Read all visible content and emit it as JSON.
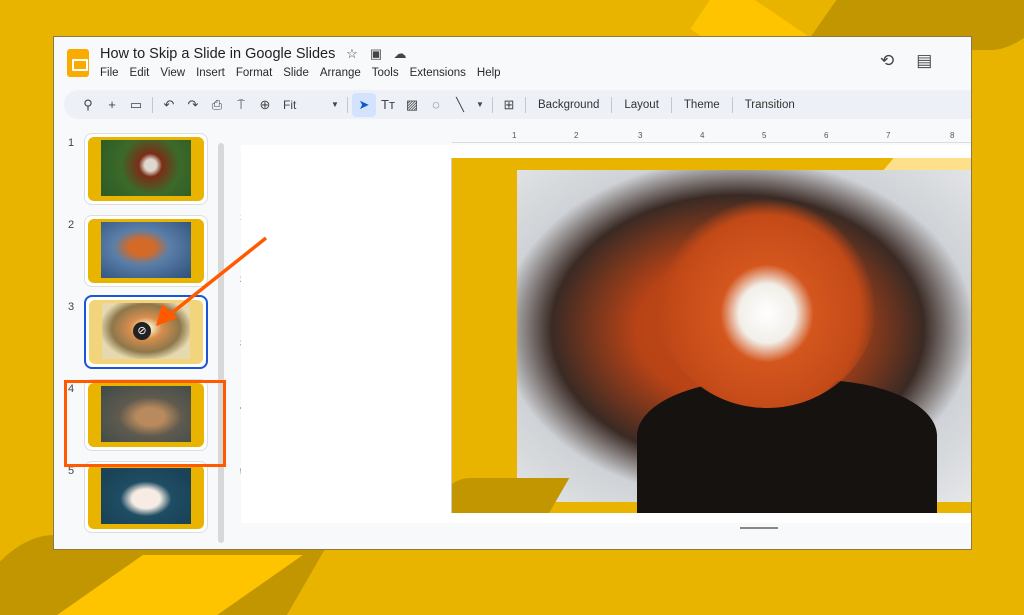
{
  "app": {
    "title": "How to Skip a Slide in Google Slides",
    "title_icons": [
      "star-icon",
      "move-folder-icon",
      "cloud-saved-icon"
    ],
    "menu": [
      "File",
      "Edit",
      "View",
      "Insert",
      "Format",
      "Slide",
      "Arrange",
      "Tools",
      "Extensions",
      "Help"
    ],
    "top_right_icons": [
      "version-history-icon",
      "comments-icon"
    ]
  },
  "toolbar": {
    "zoom_value": "Fit",
    "background_label": "Background",
    "layout_label": "Layout",
    "theme_label": "Theme",
    "transition_label": "Transition"
  },
  "rulers": {
    "horizontal": [
      "1",
      "2",
      "3",
      "4",
      "5",
      "6",
      "7",
      "8"
    ],
    "vertical": [
      "1",
      "2",
      "3",
      "4",
      "5"
    ]
  },
  "slides": [
    {
      "number": "1",
      "subject": "red panda eating bamboo",
      "skipped": false
    },
    {
      "number": "2",
      "subject": "red fox",
      "skipped": false
    },
    {
      "number": "3",
      "subject": "red panda close-up",
      "skipped": true,
      "selected": true
    },
    {
      "number": "4",
      "subject": "deer",
      "skipped": false
    },
    {
      "number": "5",
      "subject": "white rabbit",
      "skipped": false
    }
  ],
  "annotation": {
    "highlight_color": "#ff5a00",
    "target": "slide 3 skipped indicator"
  },
  "colors": {
    "brand_yellow": "#e8b400",
    "selection_blue": "#1a56d6"
  }
}
